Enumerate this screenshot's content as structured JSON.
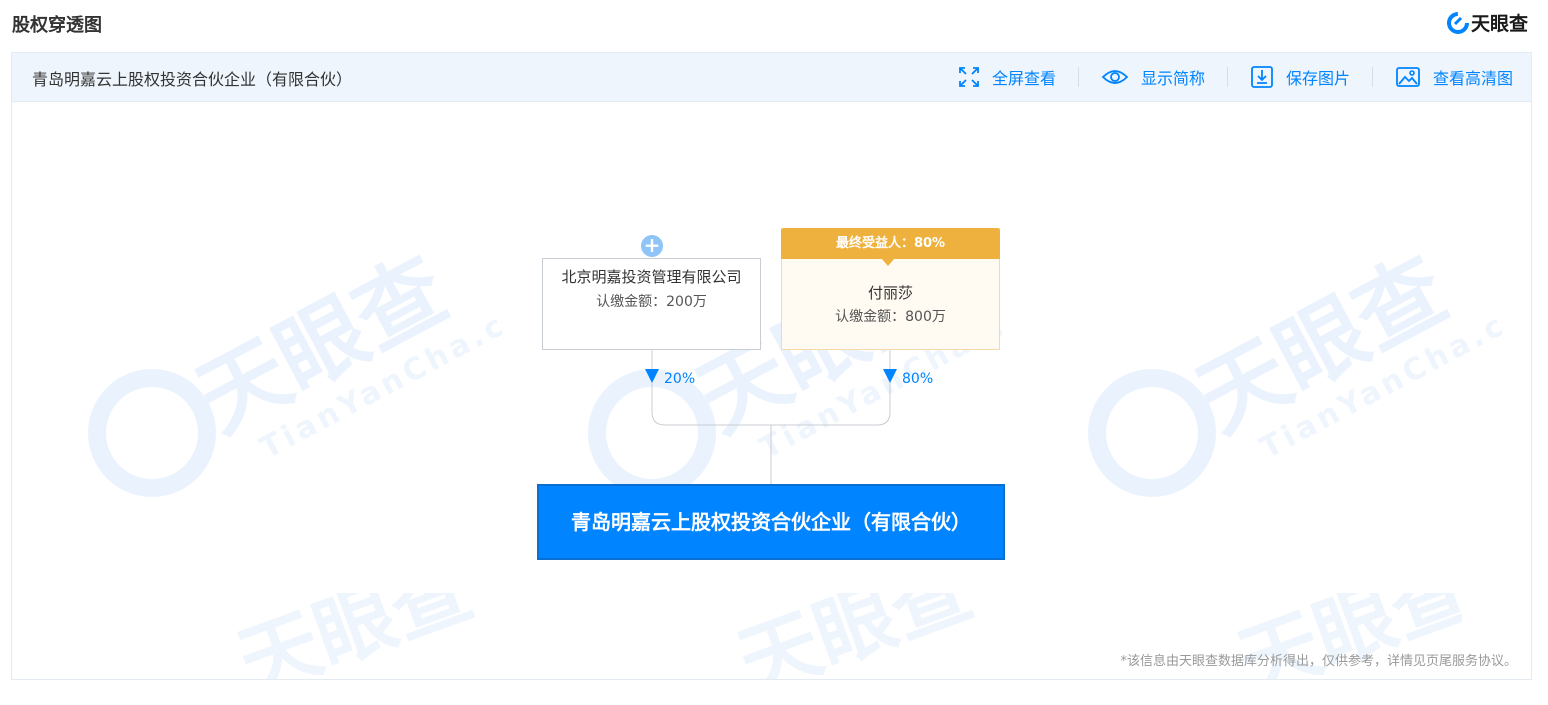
{
  "header": {
    "title": "股权穿透图",
    "brand": "天眼查"
  },
  "toolbar": {
    "company": "青岛明嘉云上股权投资合伙企业（有限合伙）",
    "actions": [
      {
        "label": "全屏查看",
        "icon": "fullscreen-icon"
      },
      {
        "label": "显示简称",
        "icon": "eye-icon"
      },
      {
        "label": "保存图片",
        "icon": "download-icon"
      },
      {
        "label": "查看高清图",
        "icon": "image-icon"
      }
    ]
  },
  "watermark": {
    "brand": "天眼查",
    "url": "TianYanCha.com"
  },
  "diagram": {
    "shareholders": [
      {
        "name": "北京明嘉投资管理有限公司",
        "subscribed": "认缴金额：200万",
        "ratio": "20%",
        "expandable": true
      },
      {
        "name": "付丽莎",
        "subscribed": "认缴金额：800万",
        "ratio": "80%",
        "badge": "最终受益人：80%"
      }
    ],
    "target": "青岛明嘉云上股权投资合伙企业（有限合伙）"
  },
  "footnote": "*该信息由天眼查数据库分析得出，仅供参考，详情见页尾服务协议。",
  "colors": {
    "accent": "#0084ff",
    "ubo": "#efb13d",
    "toolbar_bg": "#eef5fc"
  }
}
